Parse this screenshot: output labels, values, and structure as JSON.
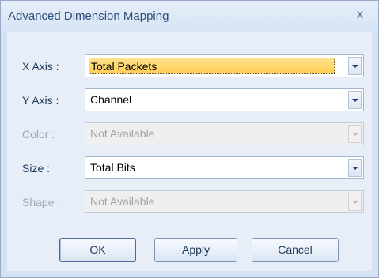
{
  "window": {
    "title": "Advanced Dimension Mapping",
    "close_glyph": "x"
  },
  "fields": [
    {
      "label": "X Axis :",
      "value": "Total Packets",
      "enabled": true,
      "focused": true
    },
    {
      "label": "Y Axis :",
      "value": "Channel",
      "enabled": true
    },
    {
      "label": "Color :",
      "value": "Not Available",
      "enabled": false
    },
    {
      "label": "Size :",
      "value": "Total Bits",
      "enabled": true
    },
    {
      "label": "Shape :",
      "value": "Not Available",
      "enabled": false
    }
  ],
  "buttons": {
    "ok": "OK",
    "apply": "Apply",
    "cancel": "Cancel"
  }
}
